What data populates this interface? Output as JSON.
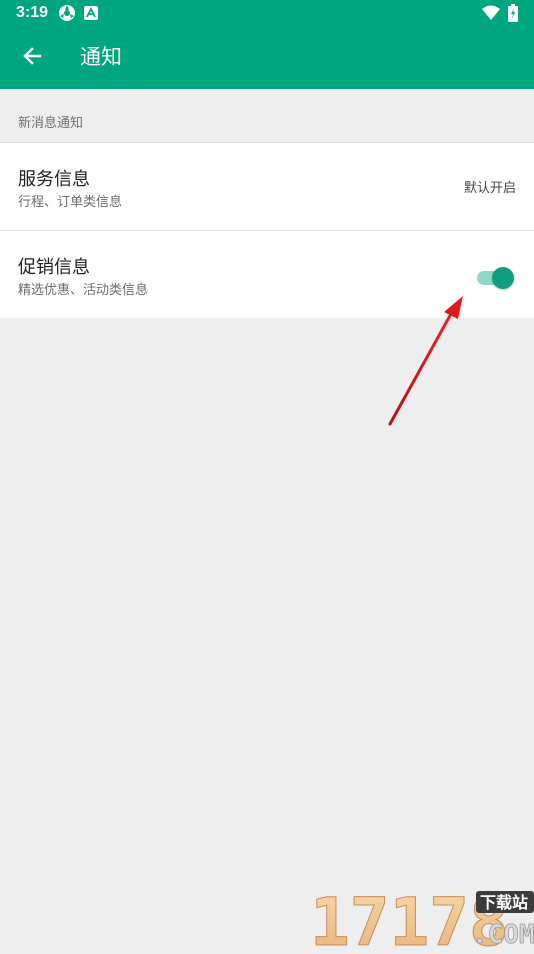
{
  "status_bar": {
    "time": "3:19",
    "icons": [
      "sync-icon",
      "a-icon",
      "wifi-icon",
      "battery-icon"
    ]
  },
  "app_bar": {
    "title": "通知",
    "back_icon": "arrow-left-icon",
    "background": "#00a67e"
  },
  "section": {
    "header": "新消息通知"
  },
  "rows": [
    {
      "title": "服务信息",
      "subtitle": "行程、订单类信息",
      "status": "默认开启"
    },
    {
      "title": "促销信息",
      "subtitle": "精选优惠、活动类信息",
      "toggle_on": true
    }
  ],
  "watermark": {
    "number": "17178",
    "label": "下载站",
    "domain": ".COM"
  },
  "colors": {
    "accent": "#00a67e",
    "toggle_thumb": "#129e7d",
    "toggle_track": "#8fd8c6",
    "annotation_arrow": "#e0191b",
    "page_background": "#eeeeee"
  }
}
